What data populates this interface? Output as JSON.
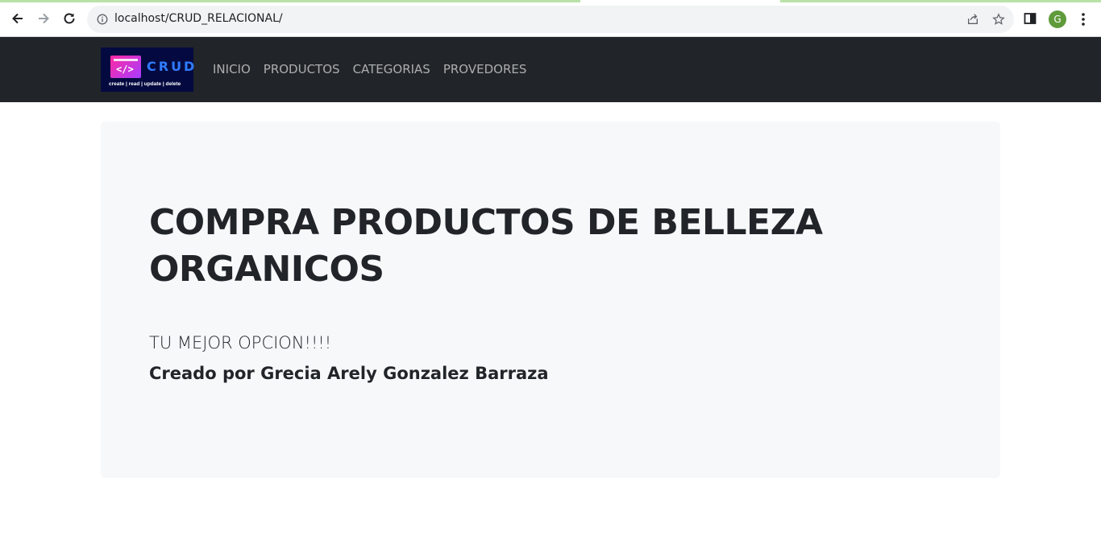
{
  "browser": {
    "url": "localhost/CRUD_RELACIONAL/",
    "profile_initial": "G",
    "icons": [
      "back-arrow-icon",
      "forward-arrow-icon",
      "reload-icon",
      "info-icon",
      "share-icon",
      "star-icon",
      "side-panel-icon",
      "kebab-menu-icon"
    ]
  },
  "navbar": {
    "logo": {
      "word": "CRUD",
      "tag": "</>",
      "tagline": "create | read | update | delete"
    },
    "links": [
      "INICIO",
      "PRODUCTOS",
      "CATEGORIAS",
      "PROVEDORES"
    ]
  },
  "hero": {
    "title": "COMPRA PRODUCTOS DE BELLEZA ORGANICOS",
    "lead": "TU MEJOR OPCION!!!!",
    "author": "Creado por Grecia Arely Gonzalez Barraza"
  },
  "colors": {
    "navbar_bg": "#212529",
    "hero_bg": "#f7f8fa",
    "text": "#212529",
    "nav_link": "rgba(255,255,255,0.62)",
    "avatar": "#5f9a3b"
  }
}
